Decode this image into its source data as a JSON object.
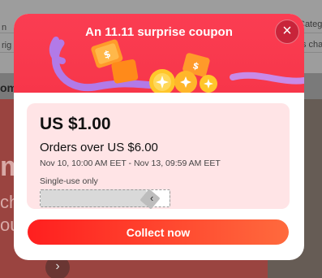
{
  "background": {
    "top_left_1": "n",
    "top_left_2": "rig",
    "top_right_1": "Categ",
    "top_right_2": "s chau",
    "side_label": "om",
    "hero_big": "m",
    "hero_small": "ch",
    "hero_small_2": "ou",
    "arrow_icon": "›"
  },
  "modal": {
    "title": "An 11.11 surprise coupon",
    "close_icon": "×",
    "coupon": {
      "amount": "US $1.00",
      "condition": "Orders over US $6.00",
      "validity": "Nov 10, 10:00 AM EET - Nov 13, 09:59 AM EET",
      "usage": "Single-use only",
      "bar_mark": "‹"
    },
    "collect_label": "Collect now"
  },
  "colors": {
    "header": "#f7364a",
    "coupon_bg": "#ffe4e6",
    "button_start": "#ff1f1f",
    "button_end": "#ff6a3d"
  }
}
